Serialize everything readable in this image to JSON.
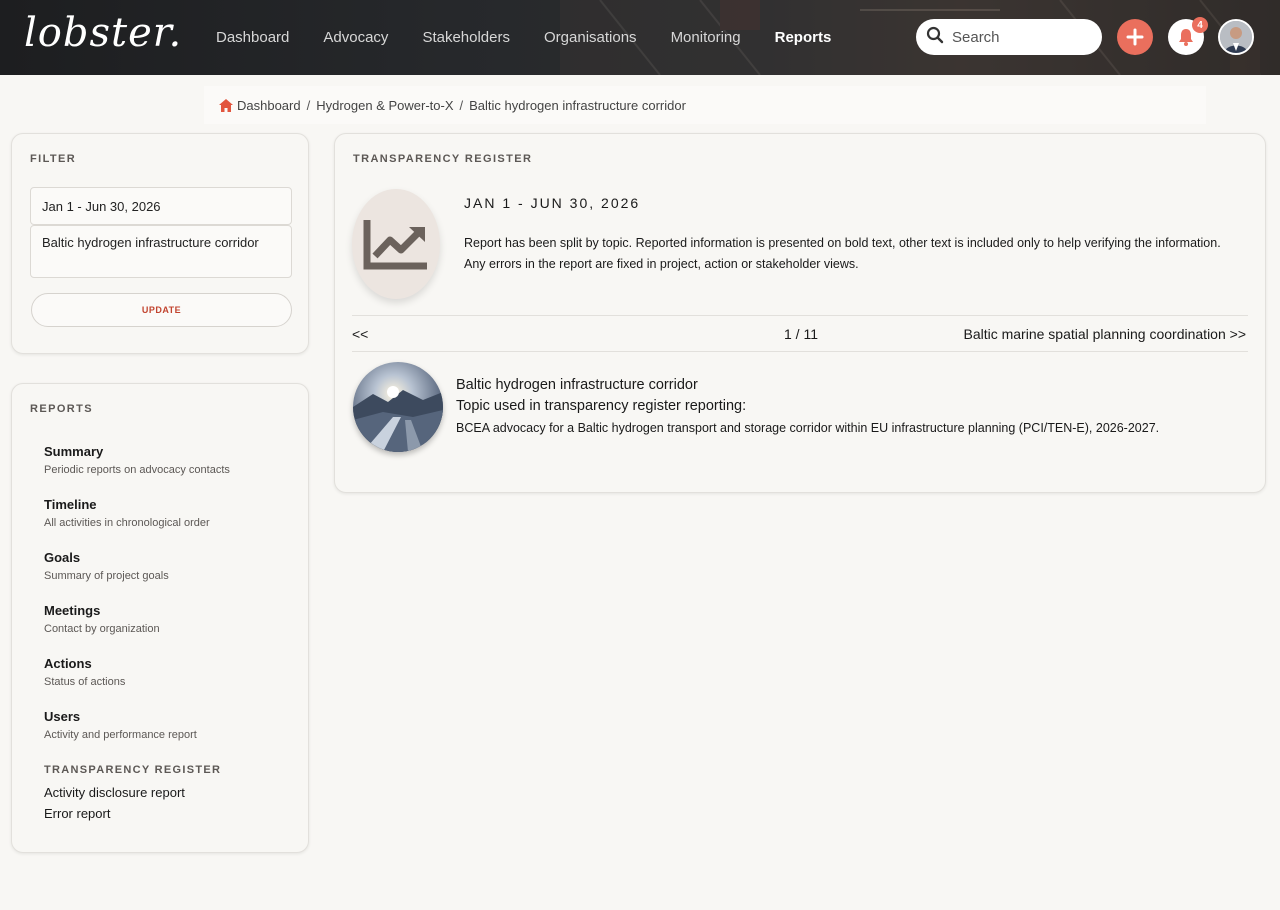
{
  "brand": {
    "logo_text": "lobster."
  },
  "nav": {
    "items": [
      {
        "label": "Dashboard",
        "active": false
      },
      {
        "label": "Advocacy",
        "active": false
      },
      {
        "label": "Stakeholders",
        "active": false
      },
      {
        "label": "Organisations",
        "active": false
      },
      {
        "label": "Monitoring",
        "active": false
      },
      {
        "label": "Reports",
        "active": true
      }
    ]
  },
  "search": {
    "placeholder": "Search",
    "value": ""
  },
  "notifications": {
    "count": "4"
  },
  "colors": {
    "accent": "#ea6f5d",
    "update_text": "#c2442f"
  },
  "breadcrumb": {
    "items": [
      "Dashboard",
      "Hydrogen & Power-to-X",
      "Baltic hydrogen infrastructure corridor"
    ],
    "separator": "/"
  },
  "filter": {
    "title": "FILTER",
    "date_range": "Jan 1 - Jun 30, 2026",
    "topic": "Baltic hydrogen infrastructure corridor",
    "update_label": "UPDATE"
  },
  "reports": {
    "title": "REPORTS",
    "items": [
      {
        "title": "Summary",
        "desc": "Periodic reports on advocacy contacts"
      },
      {
        "title": "Timeline",
        "desc": "All activities in chronological order"
      },
      {
        "title": "Goals",
        "desc": "Summary of project goals"
      },
      {
        "title": "Meetings",
        "desc": "Contact by organization"
      },
      {
        "title": "Actions",
        "desc": "Status of actions"
      },
      {
        "title": "Users",
        "desc": "Activity and performance report"
      }
    ],
    "transparency_heading": "TRANSPARENCY REGISTER",
    "transparency_links": [
      "Activity disclosure report",
      "Error report"
    ]
  },
  "register": {
    "title": "TRANSPARENCY REGISTER",
    "period": "JAN 1 - JUN 30, 2026",
    "description": "Report has been split by topic. Reported information is presented on bold text, other text is included only to help verifying the infor­mation. Any errors in the report are fixed in project, action or stakeholder views.",
    "pager": {
      "prev": "<<",
      "position": "1 / 11",
      "next": "Baltic marine spatial planning coordination >>"
    },
    "topic": {
      "title": "Baltic hydrogen infrastructure corridor",
      "subtitle": "Topic used in transparency register reporting:",
      "description": "BCEA advocacy for a Baltic hydrogen transport and storage corridor within EU infrastructure planning (PCI/TEN-E), 2026-2027."
    }
  },
  "icons": [
    "search-icon",
    "plus-icon",
    "bell-icon",
    "home-icon",
    "chart-trend-icon"
  ]
}
